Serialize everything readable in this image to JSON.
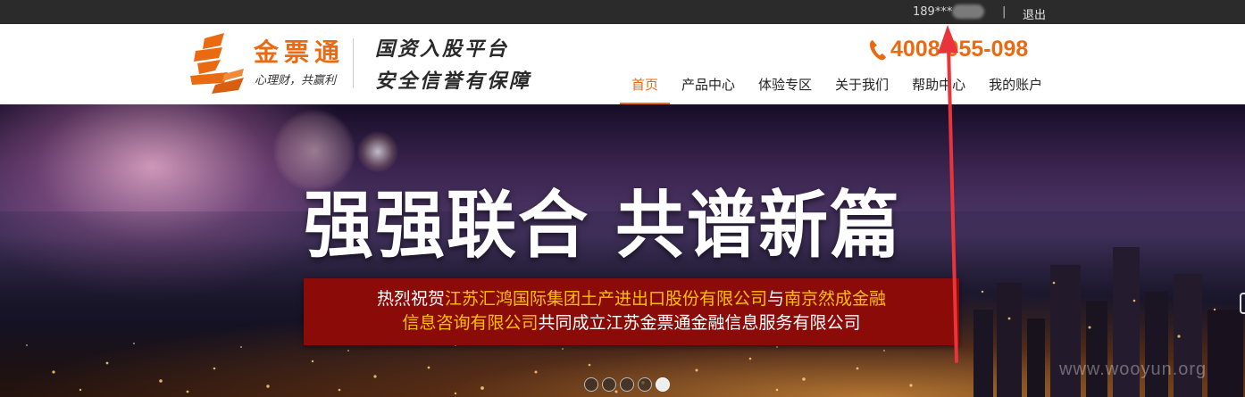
{
  "topbar": {
    "user_masked": "189***",
    "separator": "|",
    "logout_label": "退出"
  },
  "header": {
    "brand_name": "金票通",
    "brand_slogan": "心理财，共赢利",
    "tagline_line1": "国资入股平台",
    "tagline_line2": "安全信誉有保障",
    "hotline": "4008 955-098"
  },
  "nav": {
    "items": [
      {
        "label": "首页"
      },
      {
        "label": "产品中心"
      },
      {
        "label": "体验专区"
      },
      {
        "label": "关于我们"
      },
      {
        "label": "帮助中心"
      },
      {
        "label": "我的账户"
      }
    ],
    "active_index": 0
  },
  "banner": {
    "headline": "强强联合 共谱新篇",
    "caption_line1_prefix": "热烈祝贺",
    "caption_line1_company1": "江苏汇鸿国际集团土产进出口股份有限公司",
    "caption_line1_conj": "与",
    "caption_line1_company2_part1": "南京然成金融",
    "caption_line2_company2_part2": "信息咨询有限公司",
    "caption_line2_suffix": "共同成立江苏金票通金融信息服务有限公司",
    "slide_count": 5,
    "active_slide": 4
  },
  "watermark": "www.wooyun.org",
  "colors": {
    "brand_orange": "#ea6a12",
    "caption_red": "#8b0b08",
    "caption_highlight": "#ffc000",
    "annotation_arrow": "#e8343a"
  }
}
